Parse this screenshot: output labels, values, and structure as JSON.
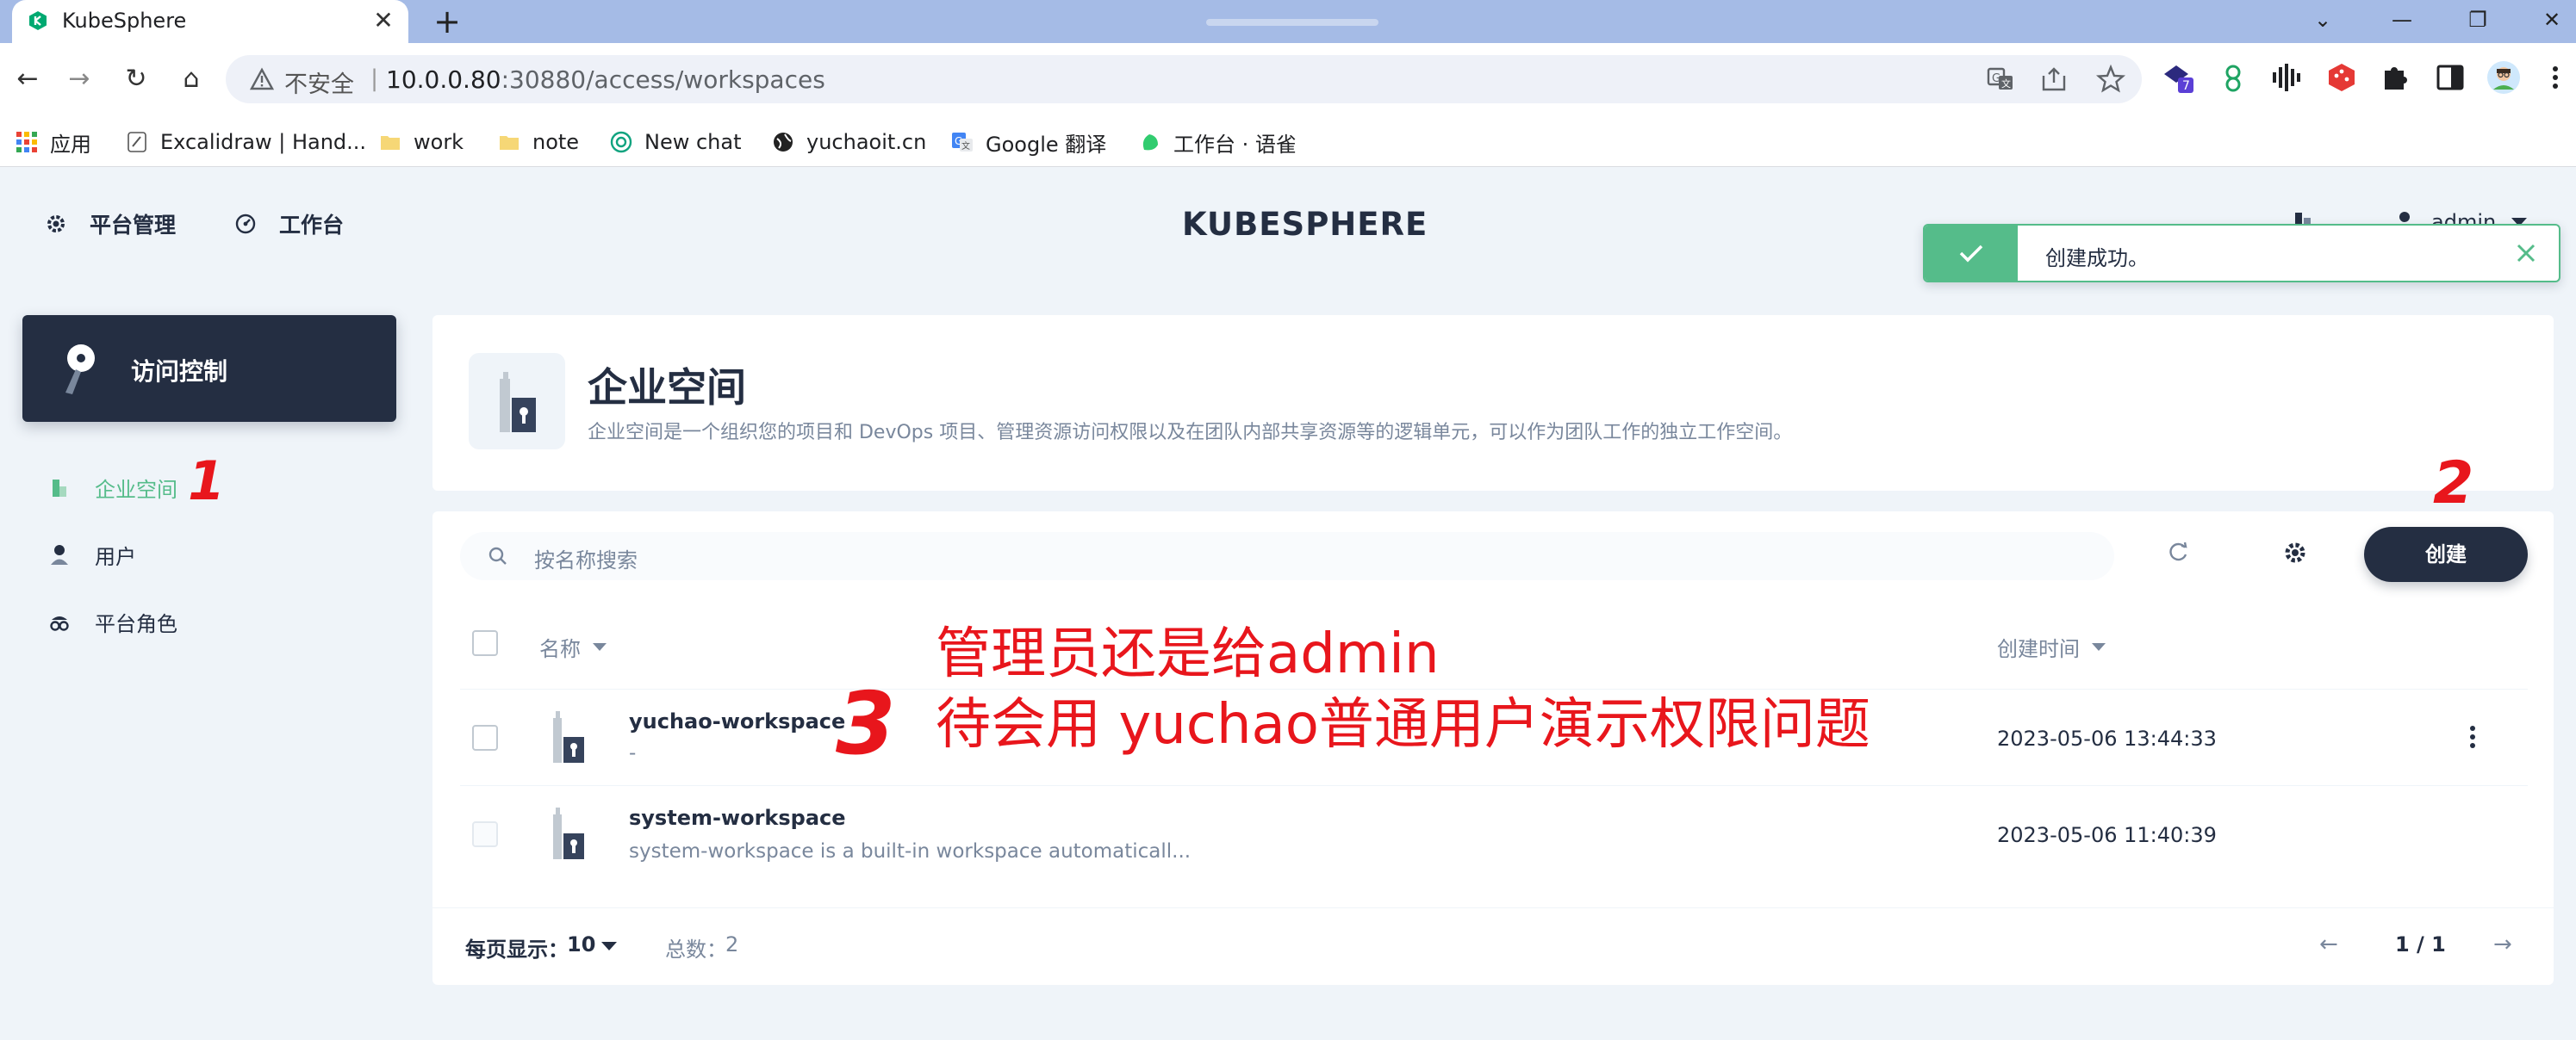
{
  "browser": {
    "tab_title": "KubeSphere",
    "tab_close": "✕",
    "new_tab": "+",
    "window_controls": [
      "⌄",
      "—",
      "❐",
      "✕"
    ],
    "nav": {
      "back": "←",
      "forward": "→",
      "reload": "↻",
      "home": "⌂"
    },
    "address": {
      "insecure_label": "不安全",
      "separator": "|",
      "host": "10.0.0.80",
      "path": ":30880/access/workspaces"
    },
    "extension_badge": "7",
    "bookmarks": [
      {
        "label": "应用",
        "icon": "apps-grid-icon"
      },
      {
        "label": "Excalidraw | Hand...",
        "icon": "excalidraw-icon"
      },
      {
        "label": "work",
        "icon": "folder-icon"
      },
      {
        "label": "note",
        "icon": "folder-icon"
      },
      {
        "label": "New chat",
        "icon": "openai-icon"
      },
      {
        "label": "yuchaoit.cn",
        "icon": "globe-icon"
      },
      {
        "label": "Google 翻译",
        "icon": "google-translate-icon"
      },
      {
        "label": "工作台 · 语雀",
        "icon": "yuque-icon"
      }
    ]
  },
  "app": {
    "topnav": {
      "platform_label": "平台管理",
      "workbench_label": "工作台",
      "logo_text": "KUBESPHERE",
      "user_name": "admin"
    },
    "toast": {
      "message": "创建成功。"
    },
    "sidebar": {
      "section_title": "访问控制",
      "items": [
        {
          "label": "企业空间",
          "active": true
        },
        {
          "label": "用户",
          "active": false
        },
        {
          "label": "平台角色",
          "active": false
        }
      ]
    },
    "banner": {
      "title": "企业空间",
      "description": "企业空间是一个组织您的项目和 DevOps 项目、管理资源访问权限以及在团队内部共享资源等的逻辑单元，可以作为团队工作的独立工作空间。"
    },
    "toolbar": {
      "search_placeholder": "按名称搜索",
      "create_label": "创建"
    },
    "table": {
      "columns": {
        "name": "名称",
        "created": "创建时间"
      },
      "rows": [
        {
          "name": "yuchao-workspace",
          "description": "-",
          "created": "2023-05-06 13:44:33"
        },
        {
          "name": "system-workspace",
          "description": "system-workspace is a built-in workspace automaticall...",
          "created": "2023-05-06 11:40:39"
        }
      ]
    },
    "pagination": {
      "page_size_label": "每页显示：",
      "page_size": "10",
      "total_label": "总数：",
      "total": "2",
      "page_indicator": "1 / 1",
      "prev": "←",
      "next": "→"
    }
  },
  "annotations": {
    "mark_1": "1",
    "mark_2": "2",
    "mark_3": "3",
    "line_1": "管理员还是给admin",
    "line_2": "待会用 yuchao普通用户演示权限问题"
  },
  "colors": {
    "brand_dark": "#242e42",
    "accent_green": "#55bc8a",
    "annotation_red": "#e8161c",
    "tabbar": "#a5bbe6"
  }
}
